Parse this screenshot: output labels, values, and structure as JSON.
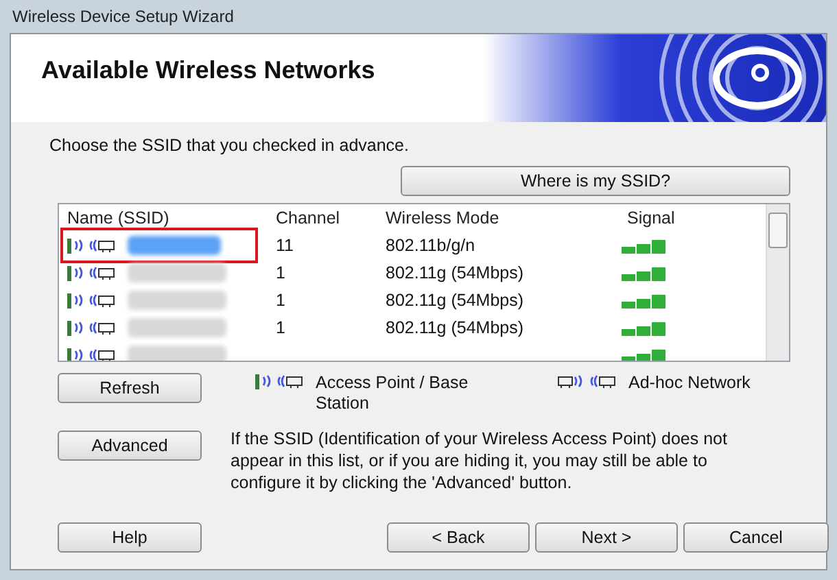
{
  "window": {
    "title": "Wireless Device Setup Wizard"
  },
  "header": {
    "title": "Available Wireless Networks"
  },
  "instruction": "Choose the SSID that you checked in advance.",
  "where_button": "Where is my SSID?",
  "table": {
    "columns": [
      "Name (SSID)",
      "Channel",
      "Wireless Mode",
      "Signal"
    ],
    "rows": [
      {
        "kind": "access-point",
        "selected": true,
        "annotated": true,
        "channel": "11",
        "mode": "802.11b/g/n"
      },
      {
        "kind": "access-point",
        "selected": false,
        "channel": "1",
        "mode": "802.11g (54Mbps)"
      },
      {
        "kind": "access-point",
        "selected": false,
        "channel": "1",
        "mode": "802.11g (54Mbps)"
      },
      {
        "kind": "access-point",
        "selected": false,
        "channel": "1",
        "mode": "802.11g (54Mbps)"
      },
      {
        "kind": "access-point",
        "selected": false
      }
    ]
  },
  "refresh_button": "Refresh",
  "legend": [
    {
      "kind": "access-point",
      "label": "Access Point / Base Station"
    },
    {
      "kind": "ad-hoc",
      "label": "Ad-hoc Network"
    }
  ],
  "advanced_button": "Advanced",
  "advanced_note": "If the SSID (Identification of your Wireless Access Point) does not appear in this list, or if you are hiding it, you may still be able to configure it by clicking the 'Advanced' button.",
  "buttons": {
    "help": "Help",
    "back": "< Back",
    "next": "Next >",
    "cancel": "Cancel"
  }
}
